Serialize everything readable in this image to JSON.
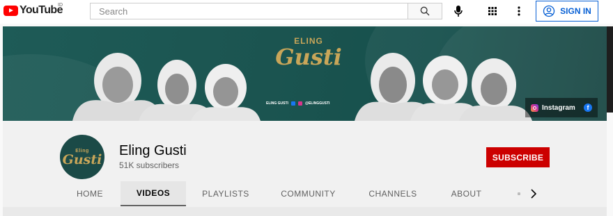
{
  "topbar": {
    "logo_text": "YouTube",
    "region": "ID",
    "search_placeholder": "Search",
    "signin_label": "SIGN IN"
  },
  "banner": {
    "brand_top": "ELING",
    "brand_main": "Gusti",
    "handle_name": "ELING GUSTI",
    "handle_at": "@ELINGGUSTI",
    "link_instagram": "Instagram"
  },
  "channel": {
    "avatar_top": "Eling",
    "avatar_main": "Gusti",
    "name": "Eling Gusti",
    "subscribers": "51K subscribers",
    "subscribe_label": "SUBSCRIBE"
  },
  "tabs": [
    {
      "label": "HOME"
    },
    {
      "label": "VIDEOS"
    },
    {
      "label": "PLAYLISTS"
    },
    {
      "label": "COMMUNITY"
    },
    {
      "label": "CHANNELS"
    },
    {
      "label": "ABOUT"
    }
  ],
  "colors": {
    "accent_red": "#cc0000",
    "link_blue": "#065fd4",
    "banner_teal": "#1b5450",
    "brand_gold": "#c9a659"
  }
}
